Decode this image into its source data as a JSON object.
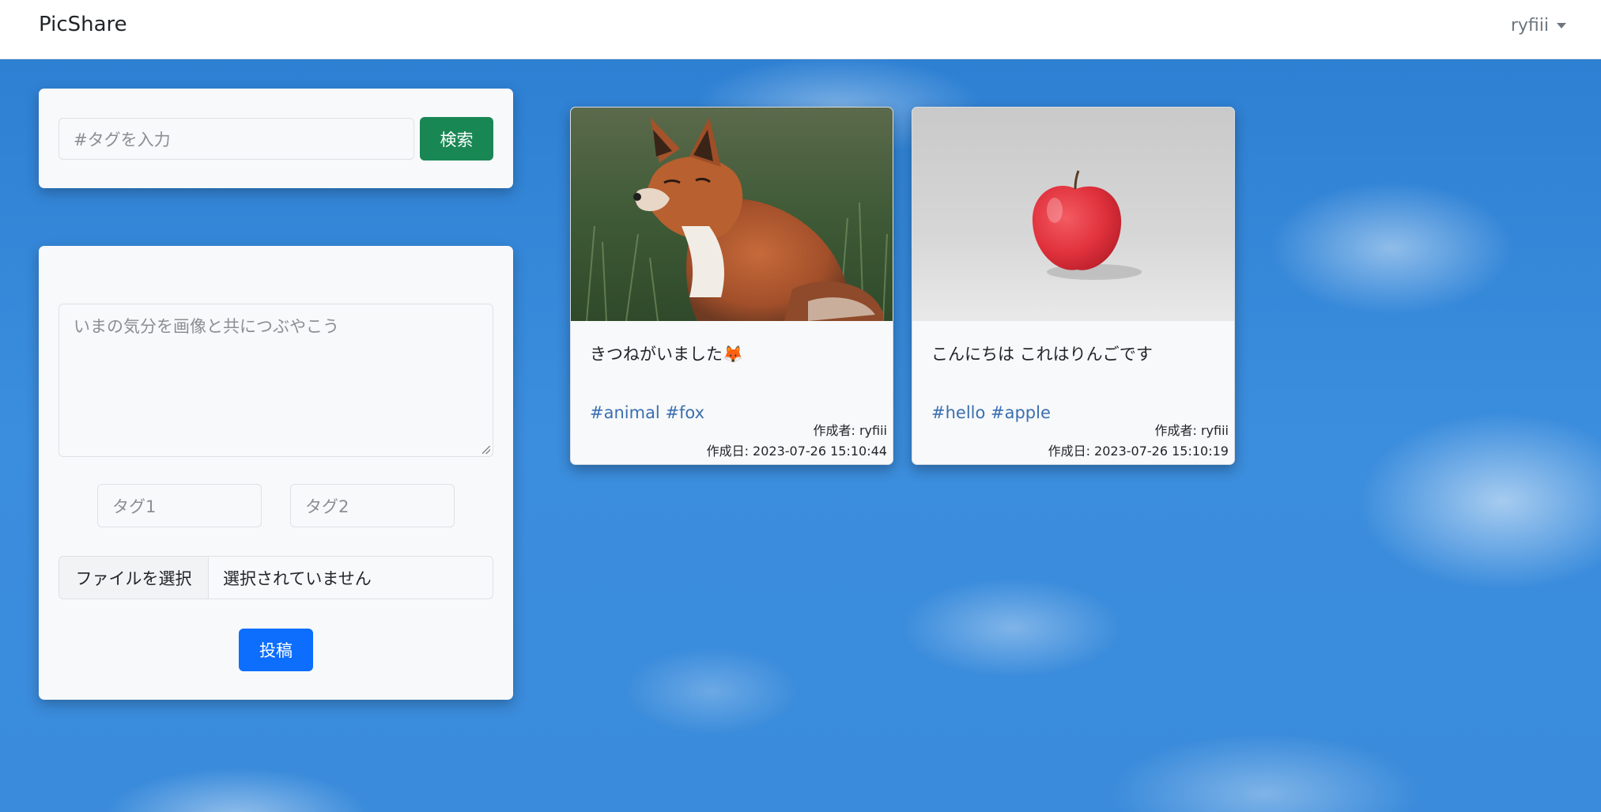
{
  "navbar": {
    "brand": "PicShare",
    "user": "ryfiii"
  },
  "search": {
    "placeholder": "#タグを入力",
    "button_label": "検索"
  },
  "post_form": {
    "textarea_placeholder": "いまの気分を画像と共につぶやこう",
    "tag1_placeholder": "タグ1",
    "tag2_placeholder": "タグ2",
    "file_button_label": "ファイルを選択",
    "file_status": "選択されていません",
    "submit_label": "投稿"
  },
  "posts": [
    {
      "image": "fox-photo",
      "text": "きつねがいました🦊",
      "tags": "#animal #fox",
      "author": "作成者: ryfiii",
      "date": "作成日: 2023-07-26 15:10:44"
    },
    {
      "image": "apple-photo",
      "text": "こんにちは これはりんごです",
      "tags": "#hello #apple",
      "author": "作成者: ryfiii",
      "date": "作成日: 2023-07-26 15:10:19"
    }
  ],
  "colors": {
    "search_button": "#198754",
    "post_button": "#0d6efd",
    "tag_link": "#3a6fb0",
    "sky": "#2f83d6"
  }
}
